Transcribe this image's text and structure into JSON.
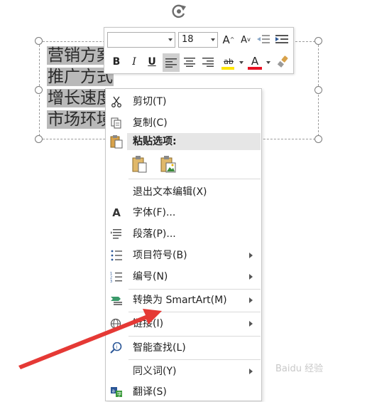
{
  "textbox": {
    "lines": [
      "营销方案",
      "推广方式",
      "增长速度",
      "市场环境"
    ]
  },
  "mini_toolbar": {
    "font_name": "",
    "font_size": "18",
    "grow_font_label": "A",
    "shrink_font_label": "A",
    "bold_label": "B",
    "italic_label": "I",
    "underline_label": "U",
    "highlight_label": "ab",
    "font_color_label": "A",
    "colors": {
      "highlight": "#ffe600",
      "font_color": "#e81123",
      "selected_bg": "#cfcfcf"
    }
  },
  "context_menu": {
    "items": [
      {
        "label": "剪切(T)",
        "icon": "scissors-icon"
      },
      {
        "label": "复制(C)",
        "icon": "copy-icon"
      },
      {
        "label": "粘贴选项:",
        "icon": "paste-icon"
      },
      {
        "label": "退出文本编辑(X)",
        "icon": ""
      },
      {
        "label": "字体(F)...",
        "icon": "font-icon"
      },
      {
        "label": "段落(P)...",
        "icon": "paragraph-icon"
      },
      {
        "label": "项目符号(B)",
        "icon": "bullets-icon",
        "submenu": true
      },
      {
        "label": "编号(N)",
        "icon": "numbering-icon",
        "submenu": true
      },
      {
        "label": "转换为 SmartArt(M)",
        "icon": "smartart-icon",
        "submenu": true
      },
      {
        "label": "链接(I)",
        "icon": "globe-link-icon",
        "submenu": true
      },
      {
        "label": "智能查找(L)",
        "icon": "smart-lookup-icon"
      },
      {
        "label": "同义词(Y)",
        "icon": "",
        "submenu": true
      },
      {
        "label": "翻译(S)",
        "icon": "translate-icon"
      }
    ]
  },
  "watermark": "Baidu 经验",
  "annotation_arrow_color": "#e53935"
}
